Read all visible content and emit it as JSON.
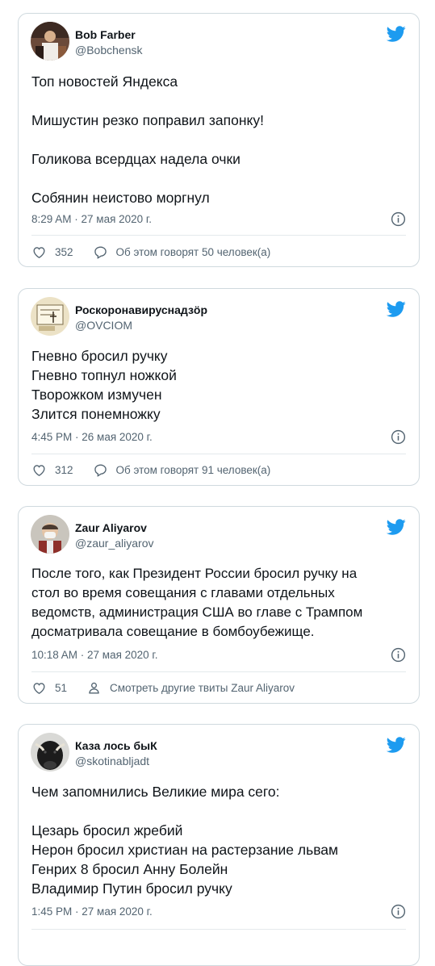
{
  "tweets": [
    {
      "name": "Bob Farber",
      "handle": "@Bobchensk",
      "lines": [
        "Топ новостей Яндекса",
        "",
        "Мишустин резко поправил запонку!",
        "",
        "Голикова всердцах надела очки",
        "",
        "Собянин неистово моргнул"
      ],
      "time": "8:29 AM · 27 мая 2020 г.",
      "likes": "352",
      "action_label": "Об этом говорят 50 человек(а)",
      "action_icon": "reply-icon"
    },
    {
      "name": "Роскоронавируснадзӧр",
      "handle": "@OVCIOM",
      "lines": [
        "Гневно бросил ручку",
        "Гневно топнул ножкой",
        "Творожком измучен",
        "Злится понемножку"
      ],
      "time": "4:45 PM · 26 мая 2020 г.",
      "likes": "312",
      "action_label": "Об этом говорят 91 человек(а)",
      "action_icon": "reply-icon"
    },
    {
      "name": "Zaur Aliyarov",
      "handle": "@zaur_aliyarov",
      "lines": [
        "После того, как Президент России бросил ручку на",
        "стол во время совещания с главами отдельных",
        "ведомств, администрация США во главе с Трампом",
        "досматривала совещание в бомбоубежище."
      ],
      "time": "10:18 AM · 27 мая 2020 г.",
      "likes": "51",
      "action_label": "Смотреть другие твиты Zaur Aliyarov",
      "action_icon": "person-icon"
    },
    {
      "name": "Каза лось быК",
      "handle": "@skotinabljadt",
      "lines": [
        "Чем запомнились Великие мира сего:",
        "",
        "Цезарь бросил жребий",
        "Нерон бросил христиан на растерзание львам",
        "Генрих 8 бросил Анну Болейн",
        "Владимир Путин бросил ручку"
      ],
      "time": "1:45 PM · 27 мая 2020 г.",
      "likes": "",
      "action_label": "",
      "action_icon": ""
    }
  ],
  "colors": {
    "bird": "#1d9bf0",
    "secondary": "#536471",
    "border": "#cfd9de"
  }
}
